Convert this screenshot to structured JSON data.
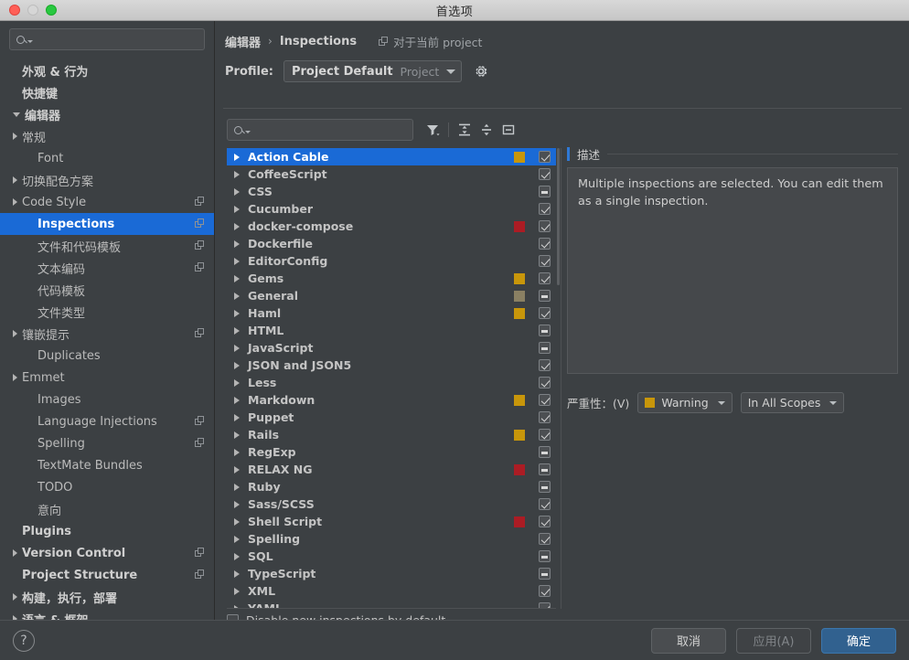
{
  "window": {
    "title": "首选项"
  },
  "sidebar": {
    "search_placeholder": "",
    "items": [
      {
        "label": "外观 & 行为",
        "level": 0,
        "arrow": "none",
        "bold": true,
        "copy": false,
        "selected": false
      },
      {
        "label": "快捷键",
        "level": 0,
        "arrow": "none",
        "bold": true,
        "copy": false,
        "selected": false
      },
      {
        "label": "编辑器",
        "level": 0,
        "arrow": "down",
        "bold": true,
        "copy": false,
        "selected": false
      },
      {
        "label": "常规",
        "level": 1,
        "arrow": "right",
        "bold": false,
        "copy": false,
        "selected": false
      },
      {
        "label": "Font",
        "level": 2,
        "arrow": "none",
        "bold": false,
        "copy": false,
        "selected": false
      },
      {
        "label": "切换配色方案",
        "level": 1,
        "arrow": "right",
        "bold": false,
        "copy": false,
        "selected": false
      },
      {
        "label": "Code Style",
        "level": 1,
        "arrow": "right",
        "bold": false,
        "copy": true,
        "selected": false
      },
      {
        "label": "Inspections",
        "level": 2,
        "arrow": "none",
        "bold": false,
        "copy": true,
        "selected": true
      },
      {
        "label": "文件和代码模板",
        "level": 2,
        "arrow": "none",
        "bold": false,
        "copy": true,
        "selected": false
      },
      {
        "label": "文本编码",
        "level": 2,
        "arrow": "none",
        "bold": false,
        "copy": true,
        "selected": false
      },
      {
        "label": "代码模板",
        "level": 2,
        "arrow": "none",
        "bold": false,
        "copy": false,
        "selected": false
      },
      {
        "label": "文件类型",
        "level": 2,
        "arrow": "none",
        "bold": false,
        "copy": false,
        "selected": false
      },
      {
        "label": "镶嵌提示",
        "level": 1,
        "arrow": "right",
        "bold": false,
        "copy": true,
        "selected": false
      },
      {
        "label": "Duplicates",
        "level": 2,
        "arrow": "none",
        "bold": false,
        "copy": false,
        "selected": false
      },
      {
        "label": "Emmet",
        "level": 1,
        "arrow": "right",
        "bold": false,
        "copy": false,
        "selected": false
      },
      {
        "label": "Images",
        "level": 2,
        "arrow": "none",
        "bold": false,
        "copy": false,
        "selected": false
      },
      {
        "label": "Language Injections",
        "level": 2,
        "arrow": "none",
        "bold": false,
        "copy": true,
        "selected": false
      },
      {
        "label": "Spelling",
        "level": 2,
        "arrow": "none",
        "bold": false,
        "copy": true,
        "selected": false
      },
      {
        "label": "TextMate Bundles",
        "level": 2,
        "arrow": "none",
        "bold": false,
        "copy": false,
        "selected": false
      },
      {
        "label": "TODO",
        "level": 2,
        "arrow": "none",
        "bold": false,
        "copy": false,
        "selected": false
      },
      {
        "label": "意向",
        "level": 2,
        "arrow": "none",
        "bold": false,
        "copy": false,
        "selected": false
      },
      {
        "label": "Plugins",
        "level": 0,
        "arrow": "none",
        "bold": true,
        "copy": false,
        "selected": false
      },
      {
        "label": "Version Control",
        "level": 0,
        "arrow": "right",
        "bold": true,
        "copy": true,
        "selected": false
      },
      {
        "label": "Project Structure",
        "level": 0,
        "arrow": "none",
        "bold": true,
        "copy": true,
        "selected": false
      },
      {
        "label": "构建，执行，部署",
        "level": 0,
        "arrow": "right",
        "bold": true,
        "copy": false,
        "selected": false
      },
      {
        "label": "语言 & 框架",
        "level": 0,
        "arrow": "right",
        "bold": true,
        "copy": false,
        "selected": false
      }
    ]
  },
  "main": {
    "breadcrumb": {
      "parent": "编辑器",
      "separator": "›",
      "current": "Inspections",
      "scope_note": "对于当前 project"
    },
    "profile": {
      "label": "Profile:",
      "value": "Project Default",
      "suffix": "Project",
      "gear_icon": "gear-icon"
    },
    "toolbar": {
      "search_placeholder": "",
      "filter_icon": "filter-icon",
      "expand_all_icon": "expand-all-icon",
      "collapse_all_icon": "collapse-all-icon",
      "group_icon": "group-by-icon"
    },
    "disable_new": {
      "label": "Disable new inspections by default",
      "checked": false
    },
    "tree": [
      {
        "name": "Action Cable",
        "state": "checked",
        "swatch": "#c8960a",
        "selected": true
      },
      {
        "name": "CoffeeScript",
        "state": "checked",
        "swatch": null,
        "selected": false
      },
      {
        "name": "CSS",
        "state": "partial",
        "swatch": null,
        "selected": false
      },
      {
        "name": "Cucumber",
        "state": "checked",
        "swatch": null,
        "selected": false
      },
      {
        "name": "docker-compose",
        "state": "checked",
        "swatch": "#ab1c24",
        "selected": false
      },
      {
        "name": "Dockerfile",
        "state": "checked",
        "swatch": null,
        "selected": false
      },
      {
        "name": "EditorConfig",
        "state": "checked",
        "swatch": null,
        "selected": false
      },
      {
        "name": "Gems",
        "state": "checked",
        "swatch": "#c8960a",
        "selected": false
      },
      {
        "name": "General",
        "state": "partial",
        "swatch": "#8a8063",
        "selected": false
      },
      {
        "name": "Haml",
        "state": "checked",
        "swatch": "#c8960a",
        "selected": false
      },
      {
        "name": "HTML",
        "state": "partial",
        "swatch": null,
        "selected": false
      },
      {
        "name": "JavaScript",
        "state": "partial",
        "swatch": null,
        "selected": false
      },
      {
        "name": "JSON and JSON5",
        "state": "checked",
        "swatch": null,
        "selected": false
      },
      {
        "name": "Less",
        "state": "checked",
        "swatch": null,
        "selected": false
      },
      {
        "name": "Markdown",
        "state": "checked",
        "swatch": "#c8960a",
        "selected": false
      },
      {
        "name": "Puppet",
        "state": "checked",
        "swatch": null,
        "selected": false
      },
      {
        "name": "Rails",
        "state": "checked",
        "swatch": "#c8960a",
        "selected": false
      },
      {
        "name": "RegExp",
        "state": "partial",
        "swatch": null,
        "selected": false
      },
      {
        "name": "RELAX NG",
        "state": "partial",
        "swatch": "#ab1c24",
        "selected": false
      },
      {
        "name": "Ruby",
        "state": "partial",
        "swatch": null,
        "selected": false
      },
      {
        "name": "Sass/SCSS",
        "state": "checked",
        "swatch": null,
        "selected": false
      },
      {
        "name": "Shell Script",
        "state": "checked",
        "swatch": "#ab1c24",
        "selected": false
      },
      {
        "name": "Spelling",
        "state": "checked",
        "swatch": null,
        "selected": false
      },
      {
        "name": "SQL",
        "state": "partial",
        "swatch": null,
        "selected": false
      },
      {
        "name": "TypeScript",
        "state": "partial",
        "swatch": null,
        "selected": false
      },
      {
        "name": "XML",
        "state": "checked",
        "swatch": null,
        "selected": false
      },
      {
        "name": "YAML",
        "state": "checked",
        "swatch": null,
        "selected": false
      }
    ],
    "description": {
      "header": "描述",
      "body": "Multiple inspections are selected. You can edit them as a single inspection."
    },
    "severity": {
      "label": "严重性：(V)",
      "value": "Warning",
      "value_swatch": "#c8960a",
      "scope": "In All Scopes"
    }
  },
  "footer": {
    "help_icon": "?",
    "cancel": "取消",
    "apply": "应用(A)",
    "ok": "确定"
  },
  "colors": {
    "accent_blue": "#1a6ad6",
    "primary_button": "#31618f",
    "warning": "#c8960a",
    "error": "#ab1c24",
    "background": "#3c4043"
  }
}
